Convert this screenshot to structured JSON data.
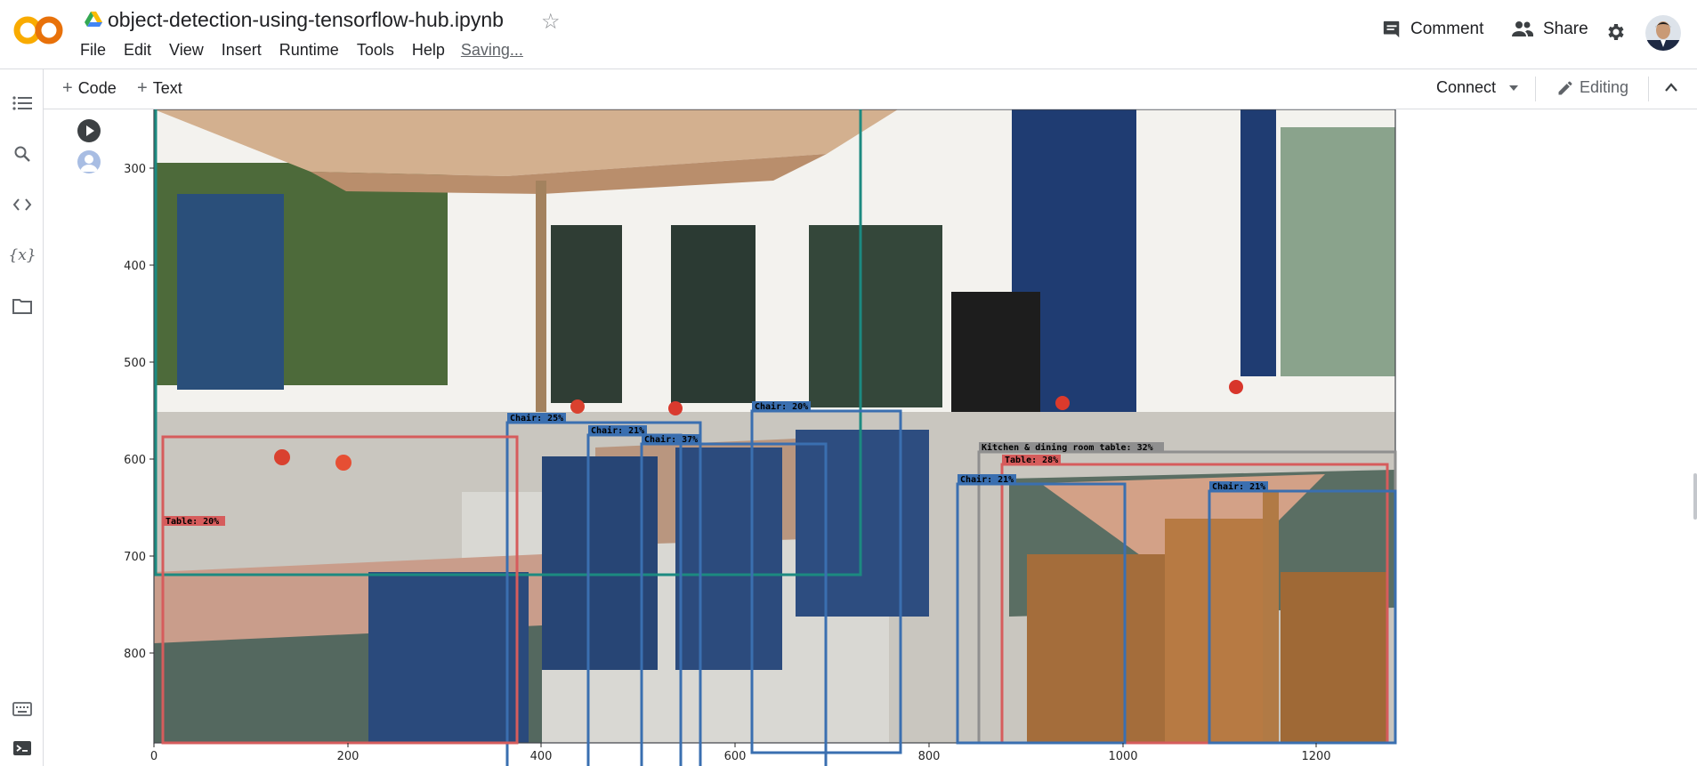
{
  "app": {
    "logo_text": "CO",
    "notebook_title": "object-detection-using-tensorflow-hub.ipynb",
    "accent_color": "#f9ab00"
  },
  "menubar": {
    "items": [
      "File",
      "Edit",
      "View",
      "Insert",
      "Runtime",
      "Tools",
      "Help"
    ],
    "status": "Saving..."
  },
  "header": {
    "comment_label": "Comment",
    "share_label": "Share"
  },
  "toolbar": {
    "add_code_label": "Code",
    "add_text_label": "Text",
    "connect_label": "Connect",
    "editing_label": "Editing"
  },
  "sidebar": {
    "icons": [
      "table-of-contents-icon",
      "search-icon",
      "code-snippets-icon",
      "variables-icon",
      "files-icon",
      "command-palette-icon",
      "terminal-icon"
    ]
  },
  "plot": {
    "x_ticks": [
      "0",
      "200",
      "400",
      "600",
      "800",
      "1000",
      "1200"
    ],
    "y_ticks": [
      "300",
      "400",
      "500",
      "600",
      "700",
      "800"
    ],
    "detections": [
      {
        "label": "Chair: 25%",
        "color": "#3a6fb0"
      },
      {
        "label": "Chair: 21%",
        "color": "#3a6fb0"
      },
      {
        "label": "Chair: 37%",
        "color": "#3a6fb0"
      },
      {
        "label": "Chair: 20%",
        "color": "#3a6fb0"
      },
      {
        "label": "Kitchen & dining room table: 32%",
        "color": "#8f8f8f"
      },
      {
        "label": "Table: 28%",
        "color": "#d65c5c"
      },
      {
        "label": "Chair: 21%",
        "color": "#3a6fb0"
      },
      {
        "label": "Chair: 21%",
        "color": "#3a6fb0"
      },
      {
        "label": "Table: 20%",
        "color": "#d65c5c"
      }
    ]
  }
}
